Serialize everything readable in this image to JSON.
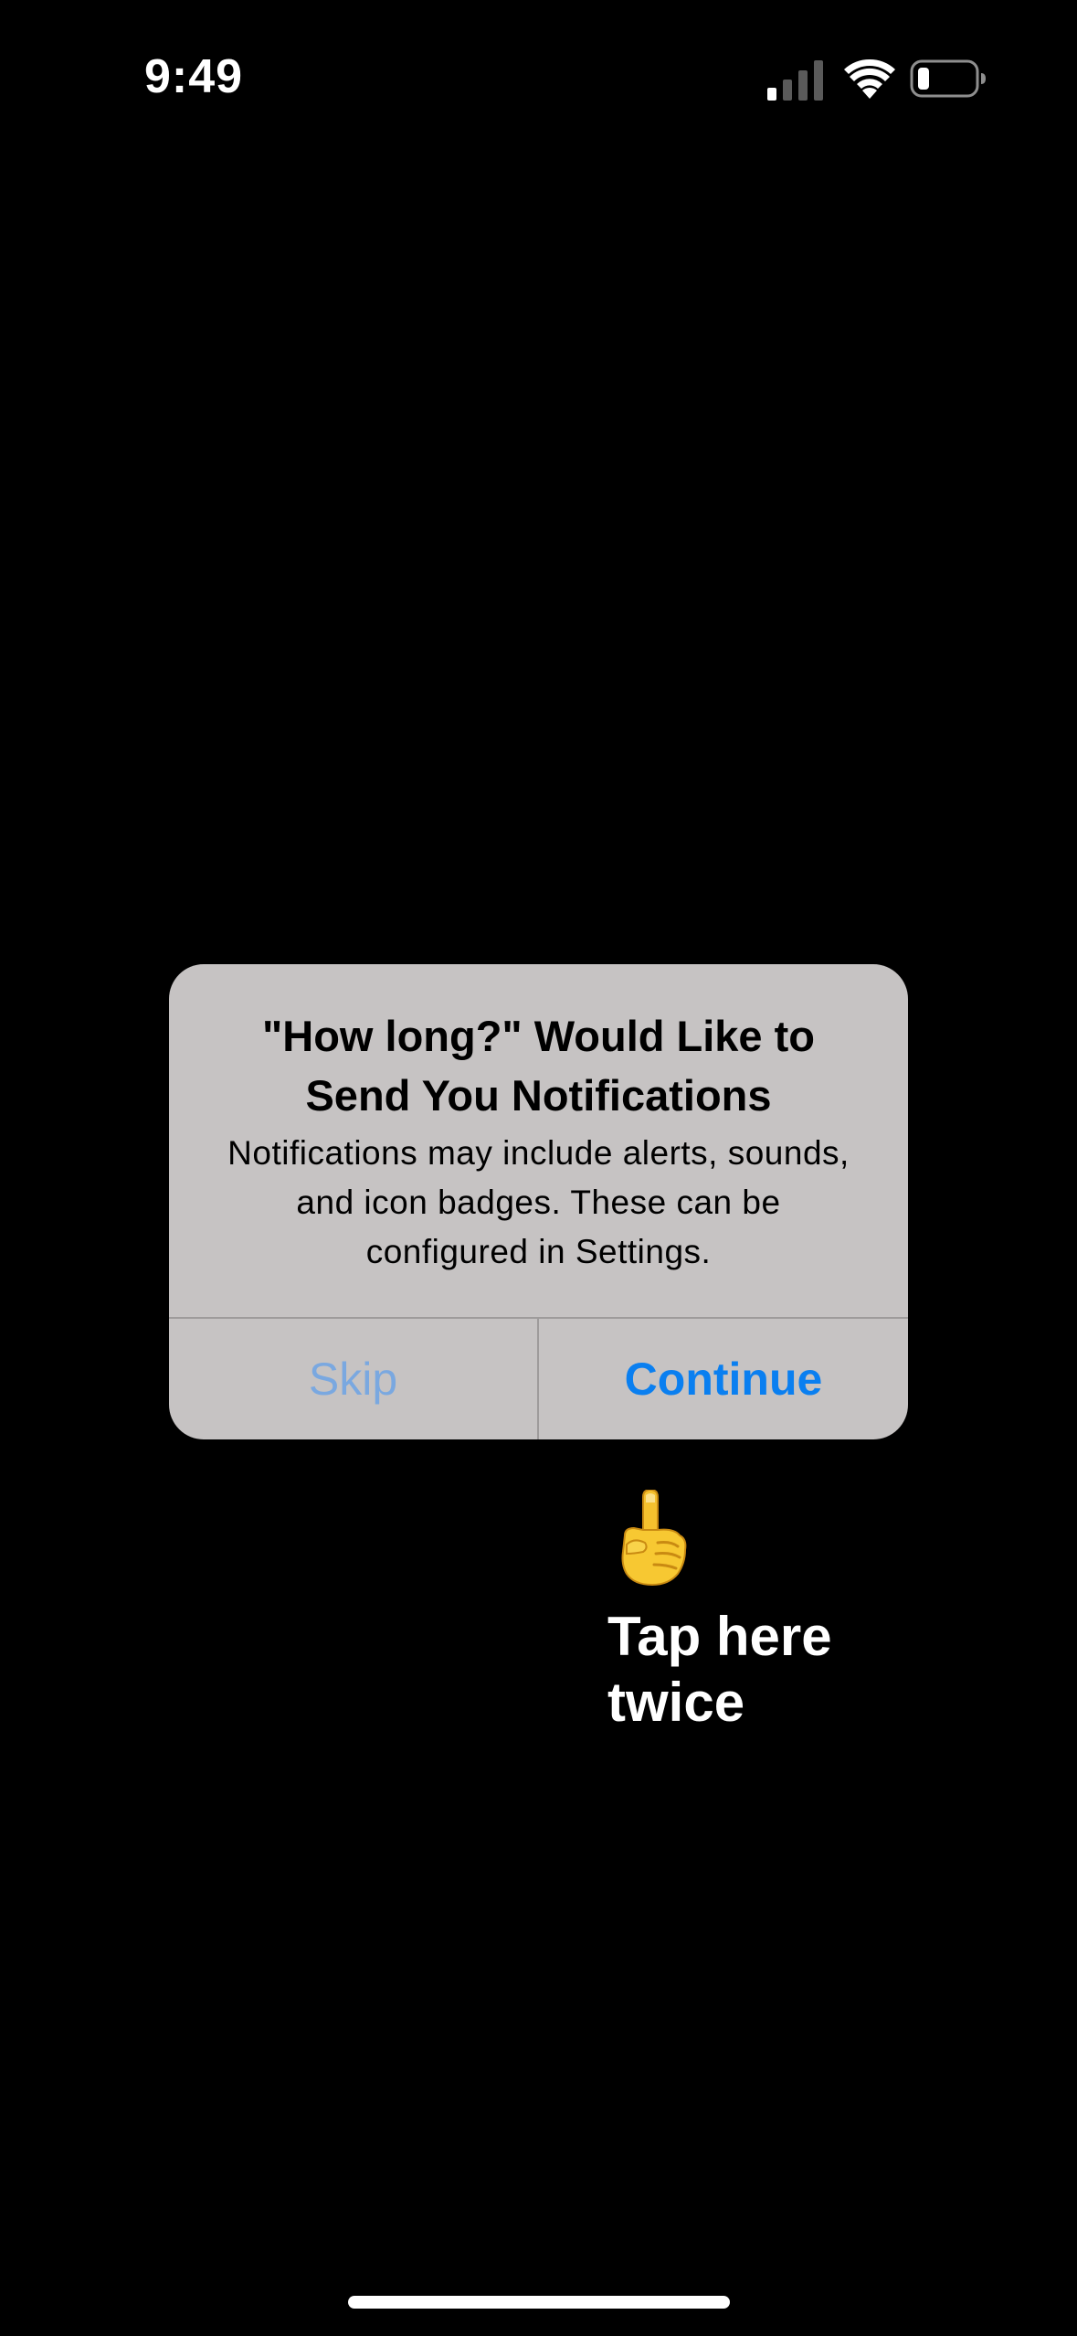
{
  "status_bar": {
    "time": "9:49",
    "icons": [
      "signal-icon",
      "wifi-icon",
      "battery-icon"
    ]
  },
  "alert": {
    "title": "\"How long?\" Would Like to Send You Notifications",
    "message": "Notifications may include alerts, sounds, and icon badges. These can be configured in Settings.",
    "buttons": {
      "skip_label": "Skip",
      "continue_label": "Continue"
    }
  },
  "hint": {
    "icon": "pointing-finger-icon",
    "text": "Tap here twice"
  },
  "colors": {
    "background": "#000000",
    "alert_background": "#c6c3c3",
    "continue": "#0a7ff0",
    "skip": "#7aa8e0"
  }
}
